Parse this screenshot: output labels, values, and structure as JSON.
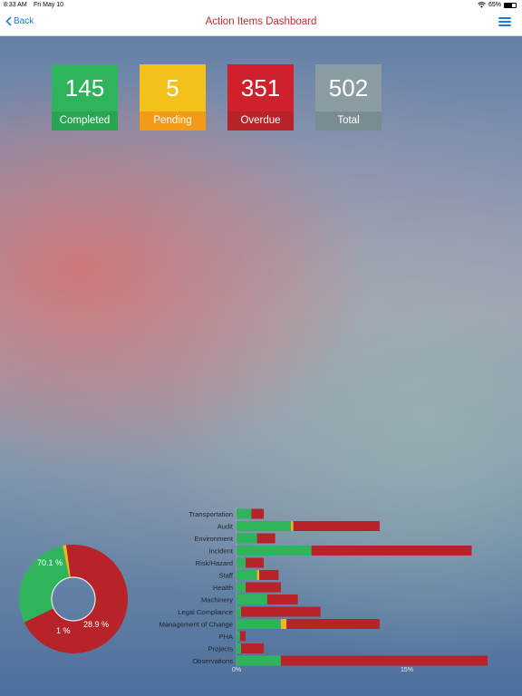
{
  "status_bar": {
    "time": "8:33 AM",
    "date": "Fri May 10",
    "battery": "65%",
    "battery_level": 0.65
  },
  "nav": {
    "back_label": "Back",
    "title": "Action Items Dashboard"
  },
  "cards": [
    {
      "value": "145",
      "label": "Completed",
      "color": "#2fb45c",
      "label_color": "#28a452"
    },
    {
      "value": "5",
      "label": "Pending",
      "color": "#f2c21a",
      "label_color": "#f39a16"
    },
    {
      "value": "351",
      "label": "Overdue",
      "color": "#d0202b",
      "label_color": "#b8232a"
    },
    {
      "value": "502",
      "label": "Total",
      "color": "#8b9da3",
      "label_color": "#7a8c92"
    }
  ],
  "colors": {
    "completed": "#2fb45c",
    "pending": "#f1b617",
    "overdue": "#b8232a"
  },
  "chart_data": [
    {
      "type": "pie",
      "donut": true,
      "slices": [
        {
          "label": "70.1 %",
          "value": 70.1,
          "color": "#b8232a"
        },
        {
          "label": "28.9 %",
          "value": 28.9,
          "color": "#2fb45c"
        },
        {
          "label": "1 %",
          "value": 1.0,
          "color": "#f1b617"
        }
      ]
    },
    {
      "type": "bar",
      "orientation": "horizontal",
      "stacked": true,
      "x_ticks": [
        "0%",
        "15%"
      ],
      "xlim": [
        0,
        22
      ],
      "categories": [
        "Transportation",
        "Audit",
        "Environment",
        "Incident",
        "Risk/Hazard",
        "Staff",
        "Health",
        "Machinery",
        "Legal Compliance",
        "Management of Change",
        "PHA",
        "Projects",
        "Observations"
      ],
      "series": [
        {
          "key": "completed",
          "values": [
            1.3,
            4.8,
            1.8,
            6.6,
            0.8,
            1.8,
            0.8,
            2.7,
            0.4,
            3.9,
            0.3,
            0.4,
            3.9
          ]
        },
        {
          "key": "pending",
          "values": [
            0,
            0.2,
            0,
            0,
            0,
            0.2,
            0,
            0,
            0,
            0.5,
            0,
            0,
            0
          ]
        },
        {
          "key": "overdue",
          "values": [
            1.1,
            7.6,
            1.6,
            14.1,
            1.6,
            1.7,
            3.1,
            2.7,
            7.0,
            8.2,
            0.5,
            2.0,
            18.2
          ]
        }
      ]
    }
  ]
}
